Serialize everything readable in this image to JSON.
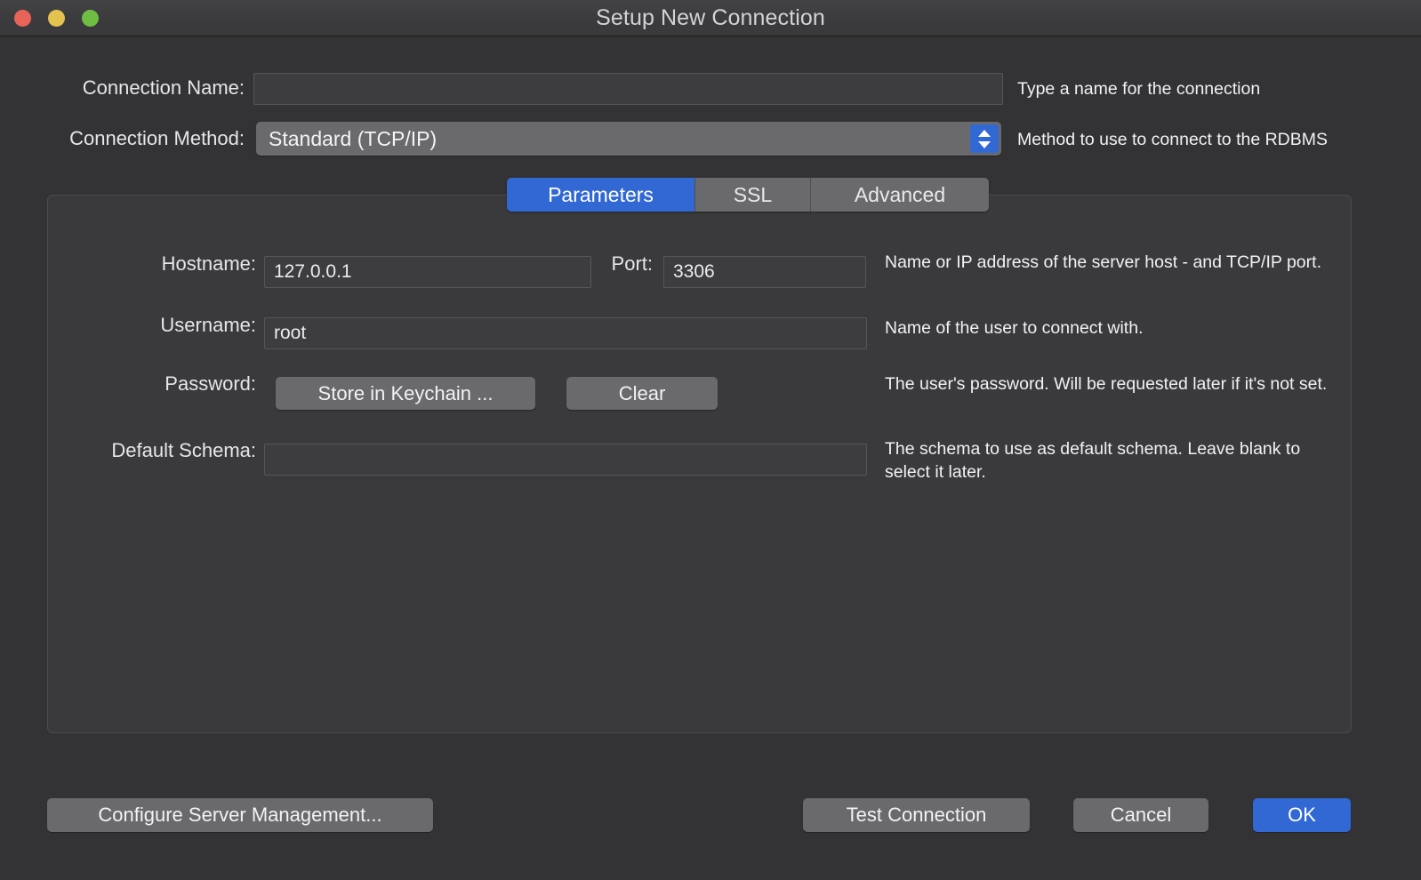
{
  "window": {
    "title": "Setup New Connection",
    "traffic_lights": [
      {
        "name": "close",
        "color": "#e8635a"
      },
      {
        "name": "minimize",
        "color": "#e3c24f"
      },
      {
        "name": "maximize",
        "color": "#6fbe44"
      }
    ]
  },
  "form": {
    "connection_name": {
      "label": "Connection Name:",
      "value": "",
      "placeholder": "",
      "hint": "Type a name for the connection"
    },
    "connection_method": {
      "label": "Connection Method:",
      "value": "Standard (TCP/IP)",
      "hint": "Method to use to connect to the RDBMS"
    }
  },
  "tabs": [
    {
      "label": "Parameters",
      "active": true
    },
    {
      "label": "SSL",
      "active": false
    },
    {
      "label": "Advanced",
      "active": false
    }
  ],
  "parameters": {
    "hostname": {
      "label": "Hostname:",
      "value": "127.0.0.1",
      "hint": "Name or IP address of the server host - and TCP/IP port."
    },
    "port": {
      "label": "Port:",
      "value": "3306"
    },
    "username": {
      "label": "Username:",
      "value": "root",
      "hint": "Name of the user to connect with."
    },
    "password": {
      "label": "Password:",
      "store_button": "Store in Keychain ...",
      "clear_button": "Clear",
      "hint": "The user's password. Will be requested later if it's not set."
    },
    "default_schema": {
      "label": "Default Schema:",
      "value": "",
      "placeholder": "",
      "hint": "The schema to use as default schema. Leave blank to select it later."
    }
  },
  "footer": {
    "configure_server_management": "Configure Server Management...",
    "test_connection": "Test Connection",
    "cancel": "Cancel",
    "ok": "OK"
  },
  "colors": {
    "accent_blue": "#3268d4",
    "window_bg": "#333335",
    "panel_bg": "#3a3a3c",
    "field_bg": "#3d3d3f",
    "control_gray": "#6a6a6c"
  }
}
